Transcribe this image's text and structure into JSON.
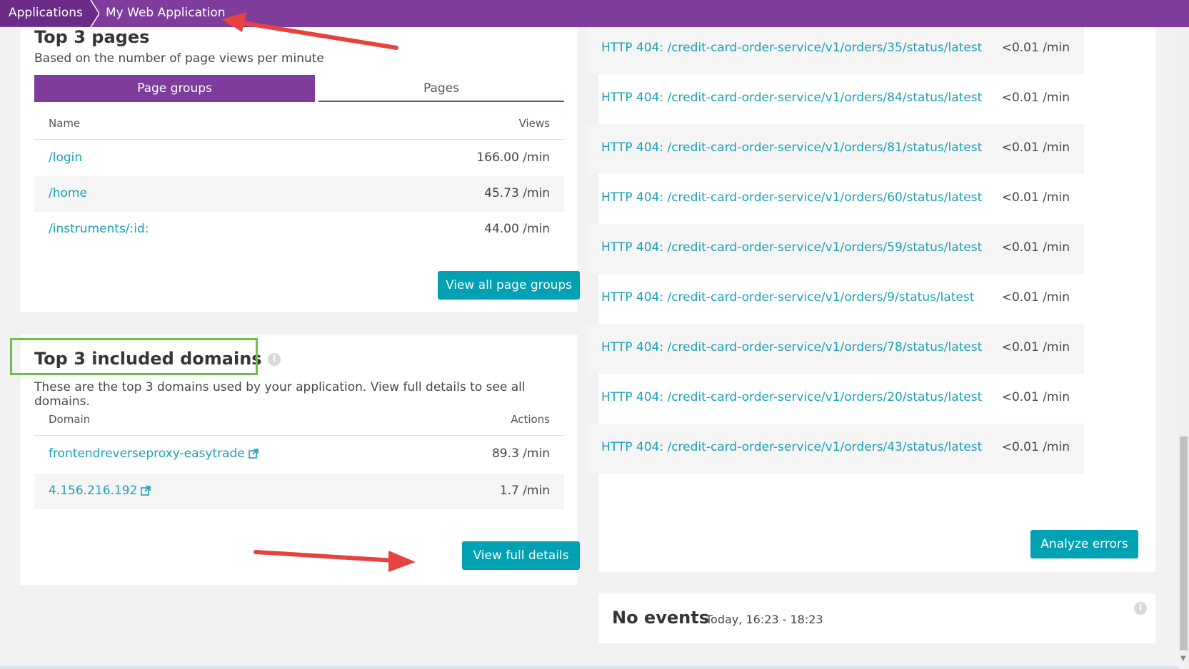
{
  "breadcrumb": {
    "items": [
      {
        "label": "Applications"
      },
      {
        "label": "My Web Application"
      }
    ]
  },
  "top_pages": {
    "title_partial": "Top 3 pages",
    "subtitle": "Based on the number of page views per minute",
    "tabs": [
      {
        "label": "Page groups",
        "active": true
      },
      {
        "label": "Pages",
        "active": false
      }
    ],
    "headers": {
      "name": "Name",
      "views": "Views"
    },
    "rows": [
      {
        "name": "/login",
        "views": "166.00 /min"
      },
      {
        "name": "/home",
        "views": "45.73 /min"
      },
      {
        "name": "/instruments/:id:",
        "views": "44.00 /min"
      }
    ],
    "button": "View all page groups"
  },
  "domains": {
    "title": "Top 3 included domains",
    "info": "i",
    "subtitle": "These are the top 3 domains used by your application. View full details to see all domains.",
    "headers": {
      "domain": "Domain",
      "actions": "Actions"
    },
    "rows": [
      {
        "domain": "frontendreverseproxy-easytrade",
        "actions": "89.3 /min"
      },
      {
        "domain": "4.156.216.192",
        "actions": "1.7 /min"
      }
    ],
    "button": "View full details"
  },
  "errors": {
    "rows": [
      {
        "name": "HTTP 404: /credit-card-order-service/v1/orders/35/status/latest",
        "rate": "<0.01 /min"
      },
      {
        "name": "HTTP 404: /credit-card-order-service/v1/orders/84/status/latest",
        "rate": "<0.01 /min"
      },
      {
        "name": "HTTP 404: /credit-card-order-service/v1/orders/81/status/latest",
        "rate": "<0.01 /min"
      },
      {
        "name": "HTTP 404: /credit-card-order-service/v1/orders/60/status/latest",
        "rate": "<0.01 /min"
      },
      {
        "name": "HTTP 404: /credit-card-order-service/v1/orders/59/status/latest",
        "rate": "<0.01 /min"
      },
      {
        "name": "HTTP 404: /credit-card-order-service/v1/orders/9/status/latest",
        "rate": "<0.01 /min"
      },
      {
        "name": "HTTP 404: /credit-card-order-service/v1/orders/78/status/latest",
        "rate": "<0.01 /min"
      },
      {
        "name": "HTTP 404: /credit-card-order-service/v1/orders/20/status/latest",
        "rate": "<0.01 /min"
      },
      {
        "name": "HTTP 404: /credit-card-order-service/v1/orders/43/status/latest",
        "rate": "<0.01 /min"
      }
    ],
    "button": "Analyze errors"
  },
  "events": {
    "title": "No events",
    "timeframe": "Today, 16:23 - 18:23",
    "info": "i"
  },
  "colors": {
    "brand_purple": "#7e3c9c",
    "link_teal": "#1ba0b7",
    "button_teal": "#00a1b2",
    "highlight_green": "#6cc04a",
    "annotation_red": "#e8423f"
  }
}
